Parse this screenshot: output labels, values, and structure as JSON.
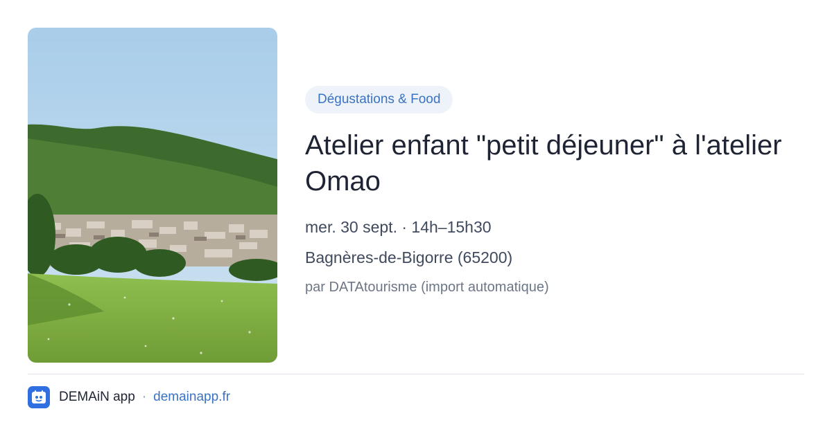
{
  "event": {
    "category": "Dégustations & Food",
    "title": "Atelier enfant \"petit déjeuner\" à l'atelier Omao",
    "datetime": "mer. 30 sept. · 14h–15h30",
    "location": "Bagnères-de-Bigorre (65200)",
    "source": "par DATAtourisme (import automatique)",
    "image_icon": "landscape-photo"
  },
  "footer": {
    "app_name": "DEMAiN app",
    "separator": "·",
    "site": "demainapp.fr",
    "icon": "app-logo-icon"
  },
  "colors": {
    "tag_bg": "#eef3fa",
    "tag_text": "#3a72c4",
    "title_text": "#1e2433",
    "link": "#3a72c4",
    "app_icon_bg": "#2f6fe0"
  }
}
